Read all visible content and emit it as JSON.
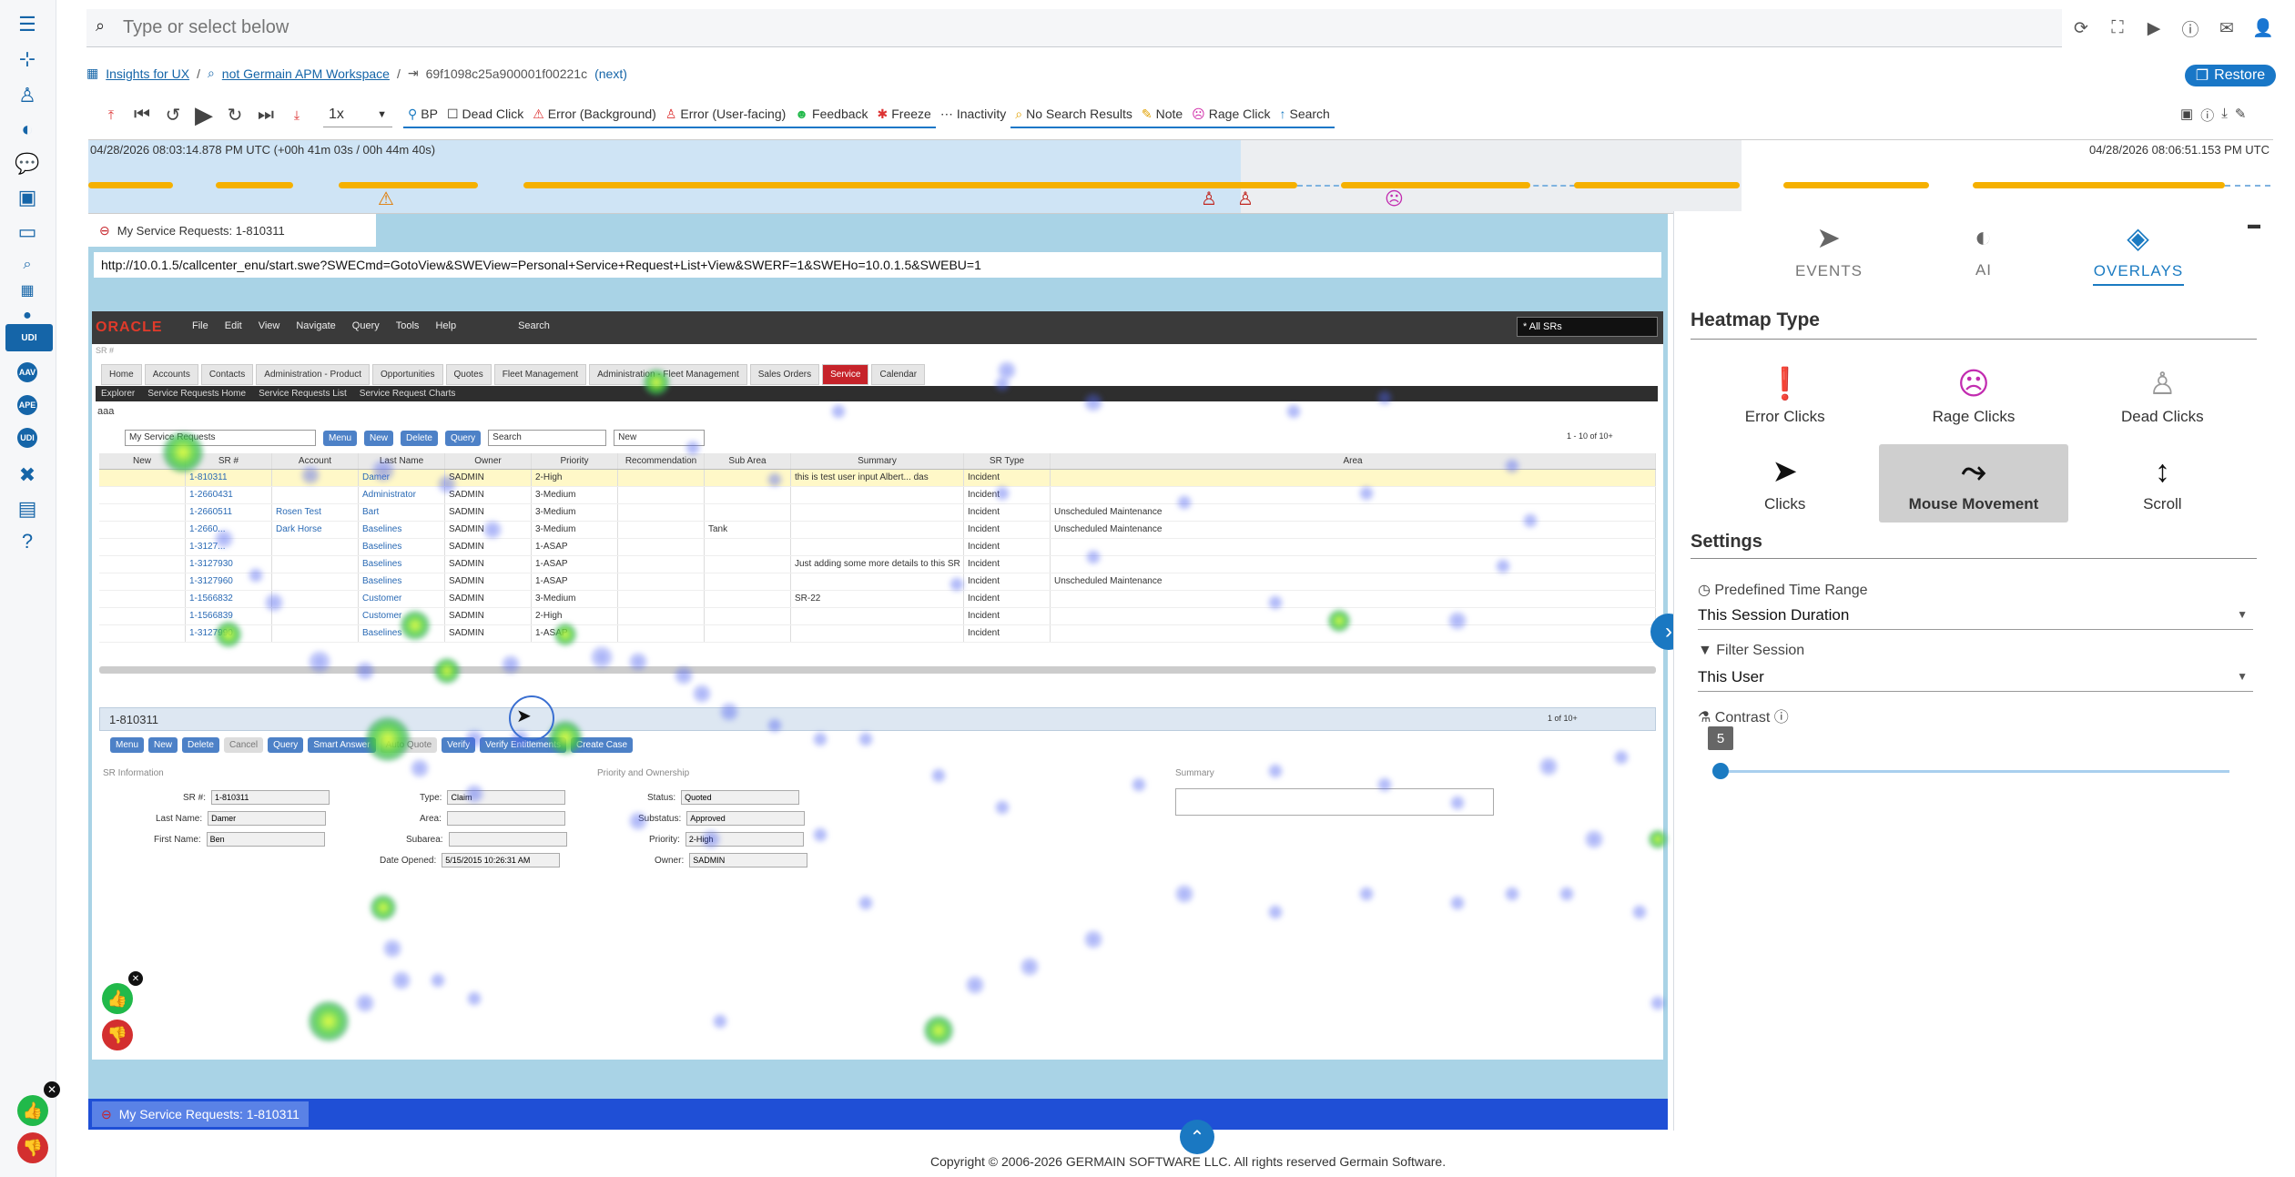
{
  "search": {
    "placeholder": "Type or select below"
  },
  "breadcrumb": {
    "item1": "Insights for UX",
    "item2": "not Germain APM Workspace",
    "item3": "69f1098c25a900001f00221c",
    "next": "(next)"
  },
  "restore_label": "Restore",
  "player": {
    "speed": "1x",
    "event_filters": [
      "BP",
      "Dead Click",
      "Error (Background)",
      "Error (User-facing)",
      "Feedback",
      "Freeze",
      "Inactivity",
      "No Search Results",
      "Note",
      "Rage Click",
      "Search"
    ]
  },
  "timeline": {
    "start": "04/28/2026 08:03:14.878 PM UTC (+00h 41m 03s / 00h 44m 40s)",
    "end": "04/28/2026 08:06:51.153 PM UTC"
  },
  "session_tab": {
    "title": "My Service Requests: 1-810311"
  },
  "url": "http://10.0.1.5/callcenter_enu/start.swe?SWECmd=GotoView&SWEView=Personal+Service+Request+List+View&SWERF=1&SWEHo=10.0.1.5&SWEBU=1",
  "siebel": {
    "logo": "ORACLE",
    "menus": [
      "File",
      "Edit",
      "View",
      "Navigate",
      "Query",
      "Tools",
      "Help"
    ],
    "search_label": "Search",
    "view_select": "* All SRs",
    "screen_label": "SR #",
    "tabs": [
      "Home",
      "Accounts",
      "Contacts",
      "Administration - Product",
      "Opportunities",
      "Quotes",
      "Fleet Management",
      "Administration - Fleet Management",
      "Sales Orders",
      "Service",
      "Calendar"
    ],
    "subnav": [
      "Explorer",
      "Service Requests Home",
      "Service Requests List",
      "Service Request Charts"
    ],
    "applet_title": "aaa",
    "query_select": "My Service Requests",
    "buttons": [
      "Menu",
      "New",
      "Delete",
      "Query"
    ],
    "search_box": "Search",
    "new_select": "New",
    "record_count": "1 - 10 of 10+",
    "columns": [
      "New",
      "SR #",
      "Account",
      "Last Name",
      "Owner",
      "Priority",
      "Recommendation",
      "Sub Area",
      "Summary",
      "SR Type",
      "Area"
    ],
    "rows": [
      [
        "",
        "1-810311",
        "",
        "Damer",
        "SADMIN",
        "2-High",
        "",
        "",
        "this is test user input Albert... das",
        "Incident",
        ""
      ],
      [
        "",
        "1-2660431",
        "",
        "Administrator",
        "SADMIN",
        "3-Medium",
        "",
        "",
        "",
        "Incident",
        ""
      ],
      [
        "",
        "1-2660511",
        "Rosen Test",
        "Bart",
        "SADMIN",
        "3-Medium",
        "",
        "",
        "",
        "Incident",
        "Unscheduled Maintenance"
      ],
      [
        "",
        "1-2660...",
        "Dark Horse",
        "Baselines",
        "SADMIN",
        "3-Medium",
        "",
        "Tank",
        "",
        "Incident",
        "Unscheduled Maintenance"
      ],
      [
        "",
        "1-3127...",
        "",
        "Baselines",
        "SADMIN",
        "1-ASAP",
        "",
        "",
        "",
        "Incident",
        ""
      ],
      [
        "",
        "1-3127930",
        "",
        "Baselines",
        "SADMIN",
        "1-ASAP",
        "",
        "",
        "Just adding some more details to this SR",
        "Incident",
        ""
      ],
      [
        "",
        "1-3127960",
        "",
        "Baselines",
        "SADMIN",
        "1-ASAP",
        "",
        "",
        "",
        "Incident",
        "Unscheduled Maintenance"
      ],
      [
        "",
        "1-1566832",
        "",
        "Customer",
        "SADMIN",
        "3-Medium",
        "",
        "",
        "SR-22",
        "Incident",
        ""
      ],
      [
        "",
        "1-1566839",
        "",
        "Customer",
        "SADMIN",
        "2-High",
        "",
        "",
        "",
        "Incident",
        ""
      ],
      [
        "",
        "1-3127990",
        "",
        "Baselines",
        "SADMIN",
        "1-ASAP",
        "",
        "",
        "",
        "Incident",
        ""
      ]
    ],
    "form_title": "1-810311",
    "form_count": "1 of 10+",
    "form_buttons": [
      "Menu",
      "New",
      "Delete",
      "Cancel",
      "Query",
      "Smart Answer",
      "Auto Quote",
      "Verify",
      "Verify Entitlements",
      "Create Case"
    ],
    "sections": [
      "SR Information",
      "Priority and Ownership",
      "Summary"
    ],
    "fields": {
      "sr_label": "SR #:",
      "sr_value": "1-810311",
      "last_name_label": "Last Name:",
      "last_name_value": "Damer",
      "first_name_label": "First Name:",
      "first_name_value": "Ben",
      "type_label": "Type:",
      "type_value": "Claim",
      "area_label": "Area:",
      "subarea_label": "Subarea:",
      "date_label": "Date Opened:",
      "date_value": "5/15/2015 10:26:31 AM",
      "status_label": "Status:",
      "status_value": "Quoted",
      "substatus_label": "Substatus:",
      "substatus_value": "Approved",
      "priority_label": "Priority:",
      "priority_value": "2-High",
      "owner_label": "Owner:",
      "owner_value": "SADMIN"
    }
  },
  "bottom_tab": "My Service Requests: 1-810311",
  "panel": {
    "tabs": [
      "EVENTS",
      "AI",
      "OVERLAYS"
    ],
    "heatmap_heading": "Heatmap Type",
    "heatmap_types": [
      "Error Clicks",
      "Rage Clicks",
      "Dead Clicks",
      "Clicks",
      "Mouse Movement",
      "Scroll"
    ],
    "settings_heading": "Settings",
    "time_range_label": "Predefined Time Range",
    "time_range_value": "This Session Duration",
    "filter_label": "Filter Session",
    "filter_value": "This User",
    "contrast_label": "Contrast",
    "contrast_value": "5"
  },
  "copyright": "Copyright © 2006-2026 GERMAIN SOFTWARE LLC. All rights reserved Germain Software."
}
